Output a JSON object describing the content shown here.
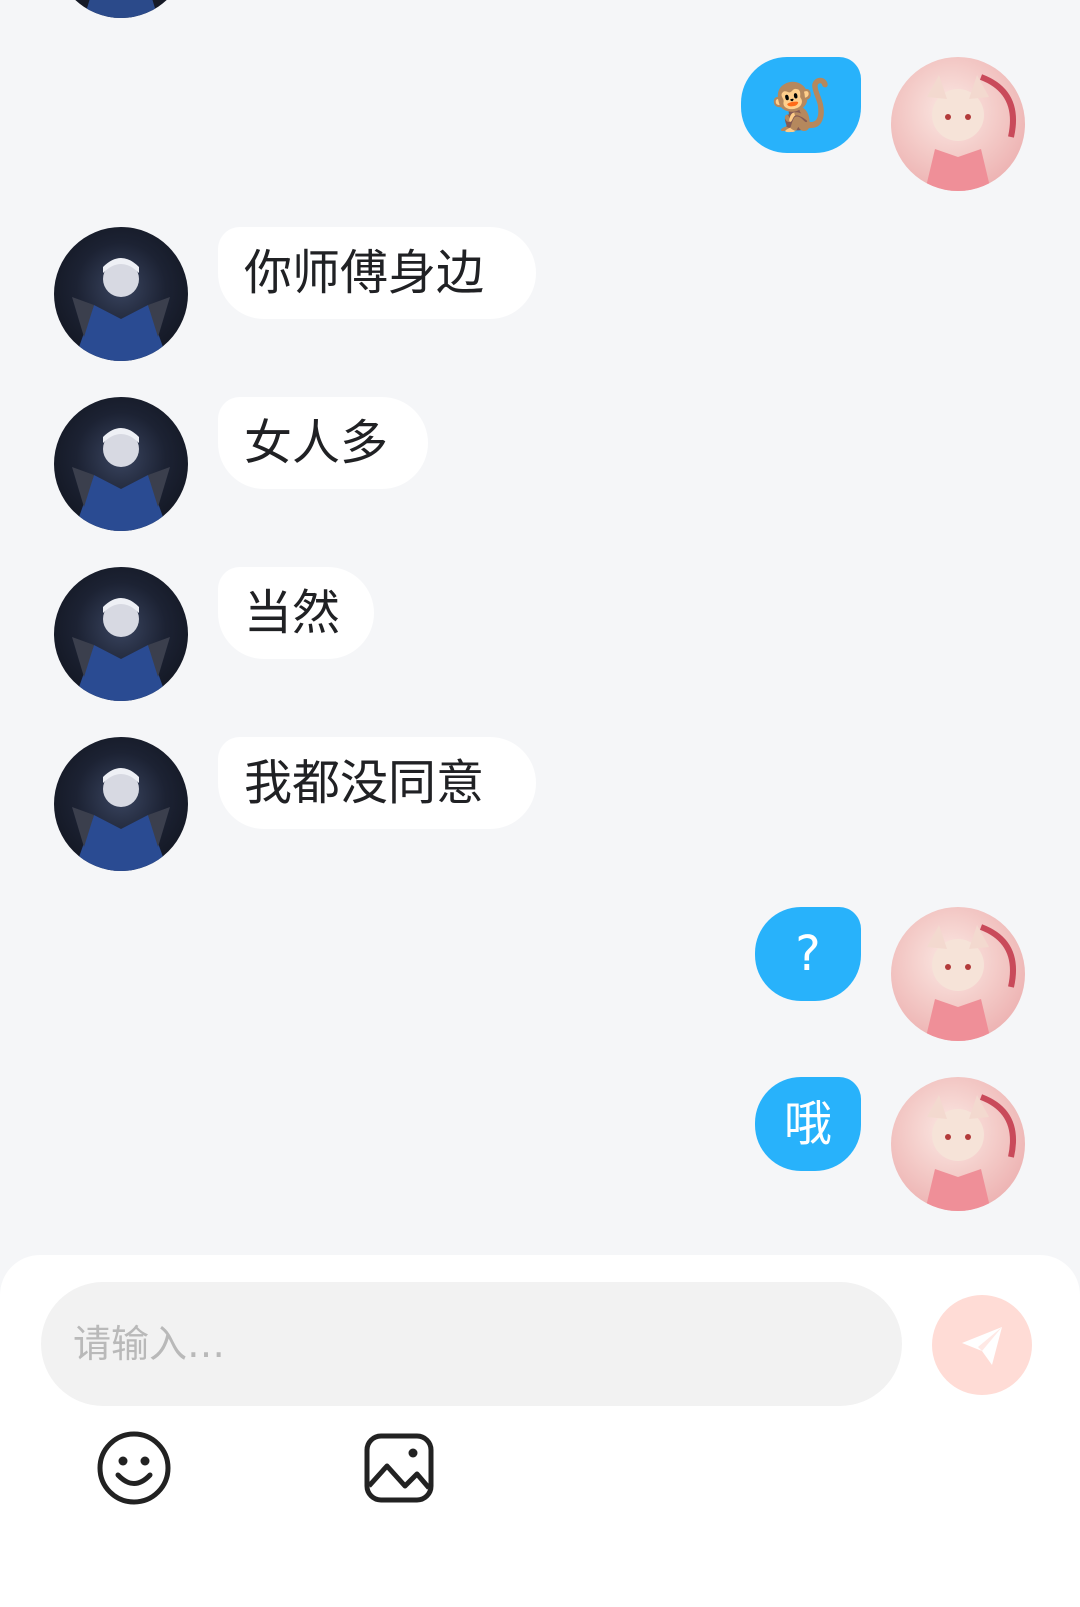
{
  "messages": [
    {
      "side": "out",
      "text": "🐒"
    },
    {
      "side": "in",
      "text": "你师傅身边"
    },
    {
      "side": "in",
      "text": "女人多"
    },
    {
      "side": "in",
      "text": "当然"
    },
    {
      "side": "in",
      "text": "我都没同意"
    },
    {
      "side": "out",
      "text": "?"
    },
    {
      "side": "out",
      "text": "哦"
    }
  ],
  "composer": {
    "placeholder": "请输入…"
  },
  "colors": {
    "outgoing_bubble": "#28b2fb",
    "incoming_bubble": "#ffffff",
    "background": "#f5f6f8",
    "send_button": "#ffdcd6"
  },
  "icons": {
    "send": "paper-plane-icon",
    "emoji": "smiley-icon",
    "image": "image-icon"
  }
}
